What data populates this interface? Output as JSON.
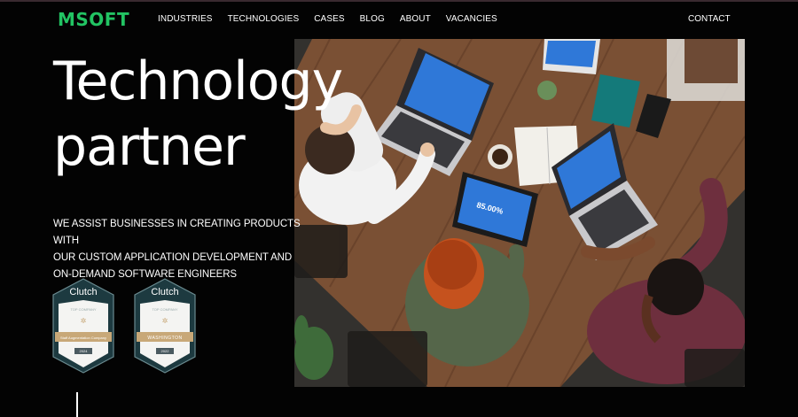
{
  "brand": {
    "logo": "MSOFT",
    "accent": "#22c463"
  },
  "nav": {
    "items": [
      "INDUSTRIES",
      "TECHNOLOGIES",
      "CASES",
      "BLOG",
      "ABOUT",
      "VACANCIES"
    ],
    "contact": "CONTACT"
  },
  "hero": {
    "headline_line1": "Technology",
    "headline_line2": "partner",
    "tagline_line1": "WE ASSIST BUSINESSES IN CREATING PRODUCTS WITH",
    "tagline_line2": "OUR CUSTOM APPLICATION DEVELOPMENT AND",
    "tagline_line3": "ON-DEMAND SOFTWARE ENGINEERS"
  },
  "badges": [
    {
      "brand": "Clutch",
      "top": "TOP COMPANY",
      "ribbon": "Staff Augmentation Company",
      "year": "2024"
    },
    {
      "brand": "Clutch",
      "top": "TOP COMPANY",
      "ribbon": "WASHINGTON",
      "year": "2022"
    }
  ],
  "photo": {
    "tablet_value": "85.00%"
  }
}
